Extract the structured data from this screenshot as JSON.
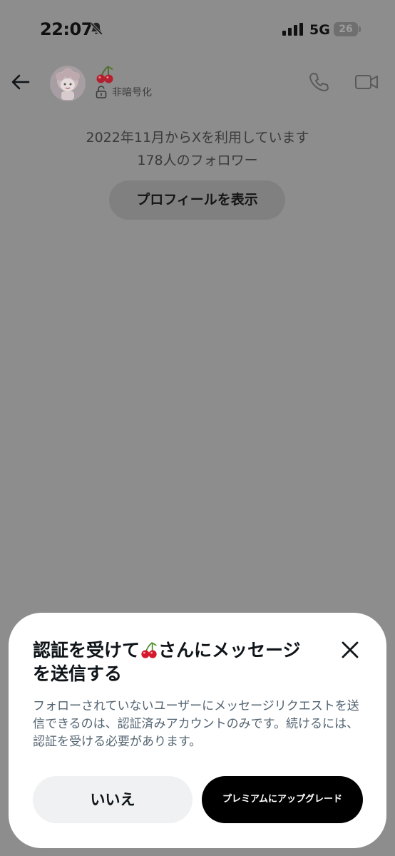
{
  "status_bar": {
    "time": "22:07",
    "network": "5G",
    "battery": "26",
    "icons": [
      "bell-slash-icon",
      "signal-icon",
      "battery-icon"
    ]
  },
  "header": {
    "contact_name_emoji": "🍒",
    "encryption_label": "非暗号化",
    "icons": [
      "back-arrow-icon",
      "open-lock-icon",
      "phone-icon",
      "video-icon"
    ]
  },
  "profile": {
    "since_text": "2022年11月からXを利用しています",
    "followers_text": "178人のフォロワー",
    "view_profile_label": "プロフィールを表示"
  },
  "sheet": {
    "title_prefix": "認証を受けて",
    "title_emoji": "🍒",
    "title_suffix": "さんにメッセージを送信する",
    "body": "フォローされていないユーザーにメッセージリクエストを送信できるのは、認証済みアカウントのみです。続けるには、認証を受ける必要があります。",
    "no_label": "いいえ",
    "upgrade_label": "プレミアムにアップグレード",
    "icons": [
      "close-icon"
    ]
  },
  "colors": {
    "overlay": "#8d8d8d",
    "sheet_bg": "#ffffff",
    "primary_button": "#000000",
    "secondary_button": "#eff1f2",
    "body_text": "#536471"
  }
}
